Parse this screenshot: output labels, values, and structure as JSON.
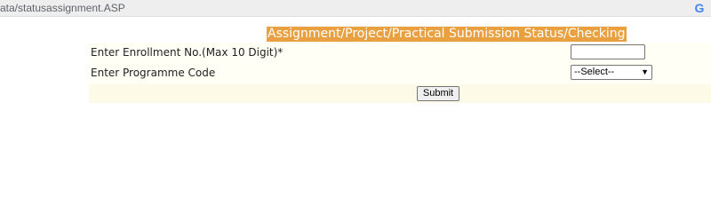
{
  "browser": {
    "url": "ata/statusassignment.ASP",
    "icon": "google-icon",
    "icon_glyph": "G"
  },
  "page": {
    "title": "Assignment/Project/Practical Submission Status/Checking",
    "title_bg_color": "#e8a040"
  },
  "form": {
    "enrollment_label": "Enter Enrollment No.(Max 10 Digit)*",
    "enrollment_value": "",
    "programme_label": "Enter Programme Code",
    "programme_selected": "--Select--",
    "submit_label": "Submit"
  }
}
